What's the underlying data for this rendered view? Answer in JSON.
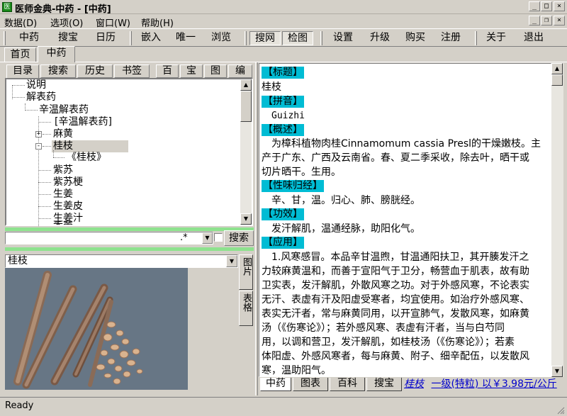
{
  "window": {
    "title": "医师金典-中药 - [中药]"
  },
  "menu": [
    "数据(D)",
    "选项(O)",
    "窗口(W)",
    "帮助(H)"
  ],
  "toolbar": {
    "groups": [
      [
        "中药",
        "搜宝",
        "日历"
      ],
      [
        "嵌入",
        "唯一",
        "浏览"
      ],
      [
        "搜网",
        "检图"
      ],
      [
        "设置",
        "升级",
        "购买",
        "注册"
      ],
      [
        "关于",
        "退出"
      ]
    ],
    "pressed": [
      "搜网",
      "检图"
    ]
  },
  "main_tabs": [
    "首页",
    "中药"
  ],
  "main_tab_active": "中药",
  "left_tabs": [
    "目录",
    "搜索",
    "历史",
    "书签",
    "百",
    "宝",
    "图",
    "编"
  ],
  "tree": [
    {
      "label": "说明",
      "level": 1
    },
    {
      "label": "解表药",
      "level": 1,
      "expanded": true
    },
    {
      "label": "辛温解表药",
      "level": 2,
      "expanded": true
    },
    {
      "label": "[辛温解表药]",
      "level": 3
    },
    {
      "label": "麻黄",
      "level": 3,
      "expander": "+"
    },
    {
      "label": "桂枝",
      "level": 3,
      "expander": "-",
      "selected": true
    },
    {
      "label": "《桂枝》",
      "level": 4
    },
    {
      "label": "紫苏",
      "level": 3
    },
    {
      "label": "紫苏梗",
      "level": 3
    },
    {
      "label": "生姜",
      "level": 3
    },
    {
      "label": "生姜皮",
      "level": 3
    },
    {
      "label": "生姜汁",
      "level": 3
    },
    {
      "label": "香薷",
      "level": 3
    }
  ],
  "search": {
    "value": ".*",
    "button": "搜索"
  },
  "image_panel": {
    "selected": "桂枝",
    "side_tabs": [
      "图片",
      "表格"
    ]
  },
  "article": {
    "sections": [
      {
        "label": "【标题】",
        "lines": [
          "桂枝"
        ]
      },
      {
        "label": "【拼音】",
        "lines": [
          "Guizhi"
        ]
      },
      {
        "label": "【概述】",
        "lines": [
          "为樟科植物肉桂Cinnamomum cassia Presl的干燥嫩枝。主",
          "产于广东、广西及云南省。春、夏二季采收，除去叶，晒干或",
          "切片晒干。生用。"
        ]
      },
      {
        "label": "【性味归经】",
        "lines": [
          "辛、甘，温。归心、肺、膀胱经。"
        ]
      },
      {
        "label": "【功效】",
        "lines": [
          "发汗解肌，温通经脉，助阳化气。"
        ]
      },
      {
        "label": "【应用】",
        "lines": [
          "1.风寒感冒。本品辛甘温煦，甘温通阳扶卫，其开腠发汗之",
          "力较麻黄温和，而善于宣阳气于卫分，畅营血于肌表，故有助",
          "卫实表，发汗解肌，外散风寒之功。对于外感风寒，不论表实",
          "无汗、表虚有汗及阳虚受寒者，均宜使用。如治疗外感风寒、",
          "表实无汗者，常与麻黄同用，以开宣肺气，发散风寒，如麻黄",
          "汤（《伤寒论》）；若外感风寒、表虚有汗者，当与白芍同",
          "用，以调和营卫，发汗解肌，如桂枝汤（《伤寒论》）；若素",
          "体阳虚、外感风寒者，每与麻黄、附子、细辛配伍，以发散风",
          "寒，温助阳气。"
        ]
      }
    ]
  },
  "bottom_tabs": [
    "中药",
    "图表",
    "百科",
    "搜宝"
  ],
  "bottom_info": {
    "name": "桂枝",
    "text": "一级(特粒) 以￥3.98元/公斤"
  },
  "status": "Ready",
  "colors": {
    "section_label": "#00bcd4",
    "chrome": "#d4d0c8",
    "link": "#0000cc",
    "green_bar": "#8ee28e",
    "app_icon": "#1a8a1a"
  }
}
